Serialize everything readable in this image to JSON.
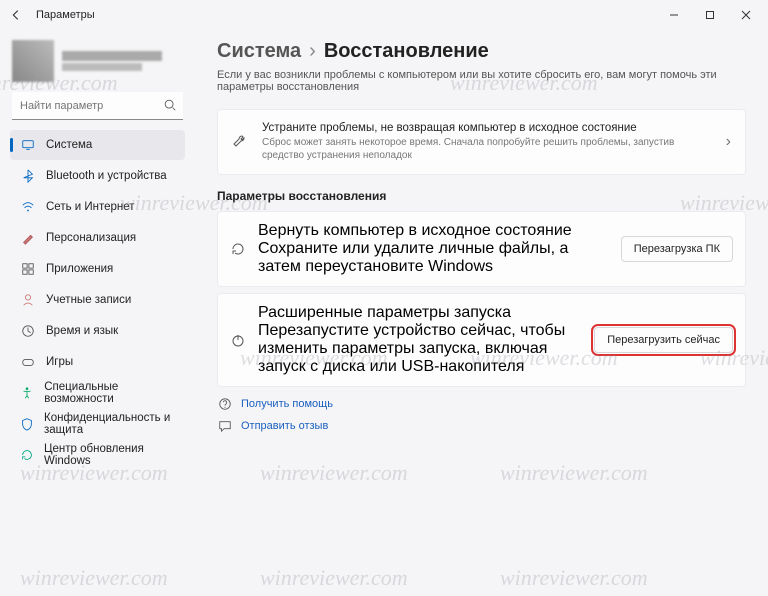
{
  "titlebar": {
    "title": "Параметры"
  },
  "search": {
    "placeholder": "Найти параметр"
  },
  "sidebar": {
    "items": [
      {
        "label": "Система"
      },
      {
        "label": "Bluetooth и устройства"
      },
      {
        "label": "Сеть и Интернет"
      },
      {
        "label": "Персонализация"
      },
      {
        "label": "Приложения"
      },
      {
        "label": "Учетные записи"
      },
      {
        "label": "Время и язык"
      },
      {
        "label": "Игры"
      },
      {
        "label": "Специальные возможности"
      },
      {
        "label": "Конфиденциальность и защита"
      },
      {
        "label": "Центр обновления Windows"
      }
    ]
  },
  "breadcrumb": {
    "root": "Система",
    "leaf": "Восстановление"
  },
  "subtitle": "Если у вас возникли проблемы с компьютером или вы хотите сбросить его, вам могут помочь эти параметры восстановления",
  "trouble": {
    "title": "Устраните проблемы, не возвращая компьютер в исходное состояние",
    "desc": "Сброс может занять некоторое время. Сначала попробуйте решить проблемы, запустив средство устранения неполадок"
  },
  "section": "Параметры восстановления",
  "reset": {
    "title": "Вернуть компьютер в исходное состояние",
    "desc": "Сохраните или удалите личные файлы, а затем переустановите Windows",
    "btn": "Перезагрузка ПК"
  },
  "advanced": {
    "title": "Расширенные параметры запуска",
    "desc": "Перезапустите устройство сейчас, чтобы изменить параметры запуска, включая запуск с диска или USB-накопителя",
    "btn": "Перезагрузить сейчас"
  },
  "links": {
    "help": "Получить помощь",
    "feedback": "Отправить отзыв"
  },
  "watermark": "winreviewer.com"
}
